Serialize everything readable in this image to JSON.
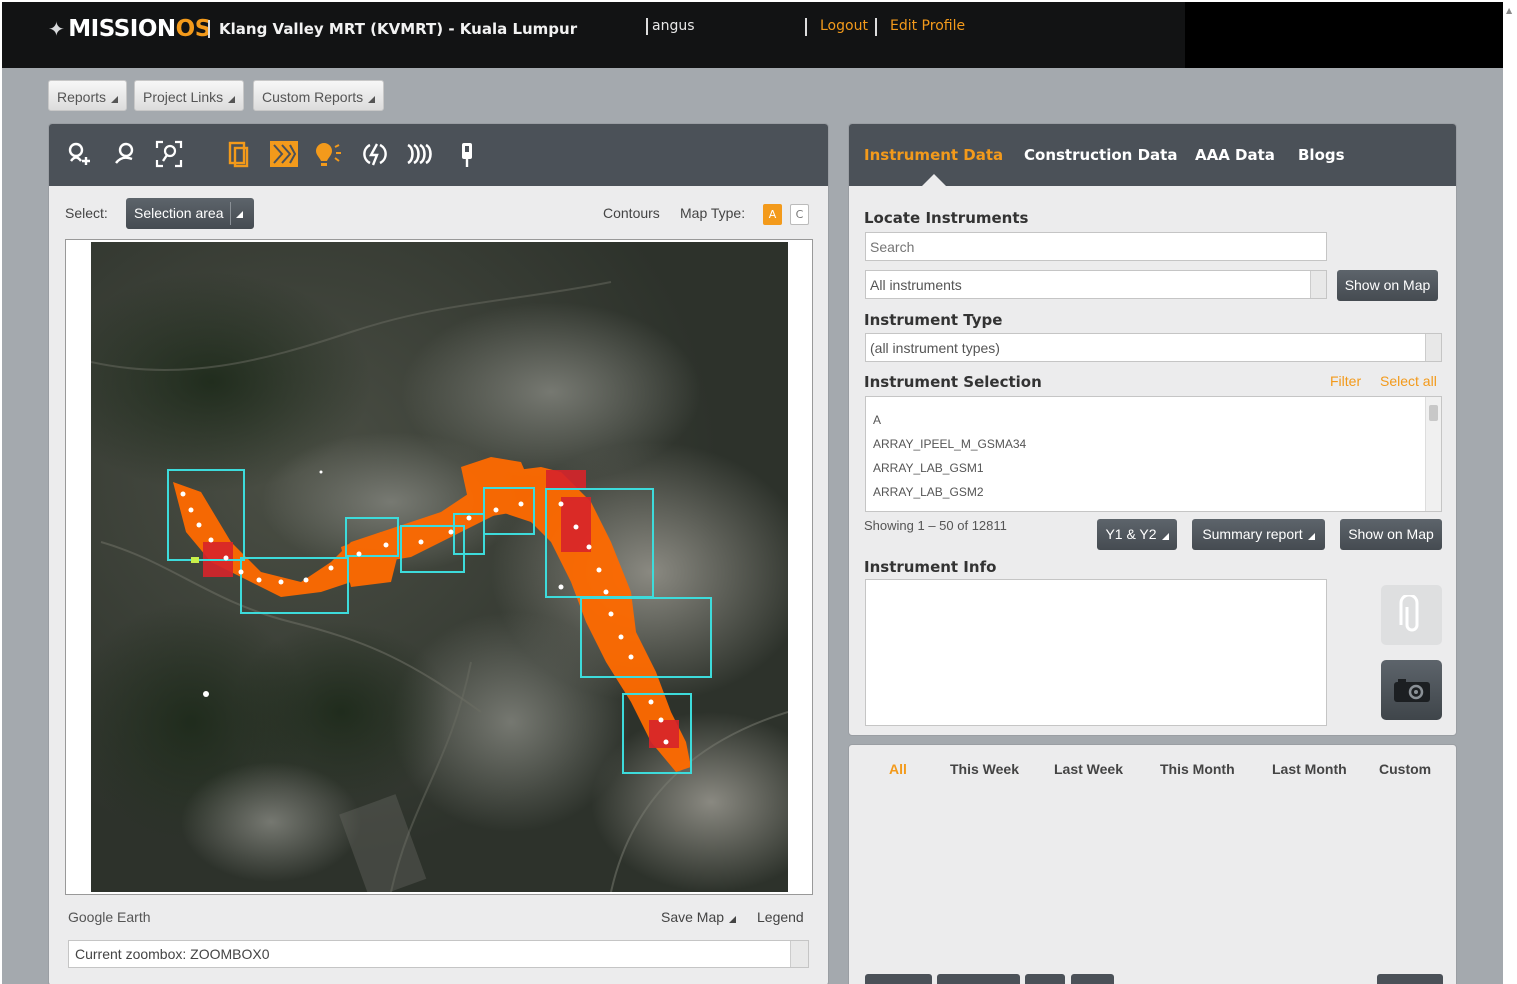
{
  "header": {
    "logo_main": "MISSION",
    "logo_os": "OS",
    "project": "Klang Valley MRT (KVMRT) - Kuala Lumpur",
    "username": "angus",
    "logout": "Logout",
    "edit_profile": "Edit Profile"
  },
  "menu": {
    "reports": "Reports",
    "project_links": "Project Links",
    "custom_reports": "Custom Reports"
  },
  "map_panel": {
    "tools": [
      "zoom-in-icon",
      "zoom-out-icon",
      "zoom-extent-icon",
      "layers-icon",
      "chevrons-icon",
      "lightbulb-icon",
      "lightning-icon",
      "waves-icon",
      "pin-icon"
    ],
    "select_label": "Select:",
    "select_value": "Selection area",
    "contours": "Contours",
    "map_type_label": "Map Type:",
    "map_type_a": "A",
    "map_type_c": "C",
    "google_earth": "Google Earth",
    "save_map": "Save Map",
    "legend": "Legend",
    "zoombox": "Current zoombox: ZOOMBOX0",
    "accent_color": "#f39a1b",
    "zone_color": "#40d9d9"
  },
  "right_panel": {
    "tabs": [
      "Instrument Data",
      "Construction Data",
      "AAA Data",
      "Blogs"
    ],
    "active_tab": "Instrument Data",
    "locate_title": "Locate Instruments",
    "search_placeholder": "Search",
    "instrument_filter": "All instruments",
    "show_on_map": "Show on Map",
    "type_title": "Instrument Type",
    "type_value": "(all instrument types)",
    "selection_title": "Instrument Selection",
    "filter": "Filter",
    "select_all": "Select all",
    "list_items": [
      "A",
      "ARRAY_IPEEL_M_GSMA34",
      "ARRAY_LAB_GSM1",
      "ARRAY_LAB_GSM2"
    ],
    "showing": "Showing 1 – 50 of 12811",
    "y1y2": "Y1 & Y2",
    "summary_report": "Summary report",
    "show_on_map_2": "Show on Map",
    "info_title": "Instrument Info"
  },
  "bottom_panel": {
    "periods": [
      "All",
      "This Week",
      "Last Week",
      "This Month",
      "Last Month",
      "Custom"
    ],
    "active_period": "All"
  }
}
